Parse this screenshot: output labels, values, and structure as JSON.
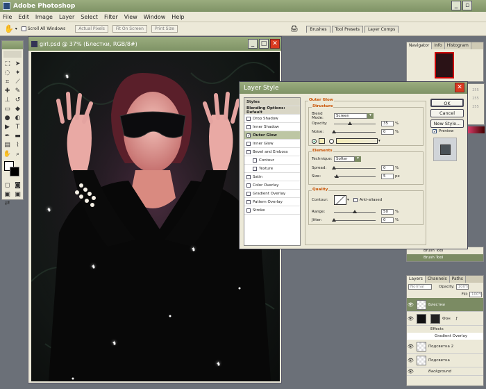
{
  "app": {
    "title": "Adobe Photoshop"
  },
  "menu": [
    "File",
    "Edit",
    "Image",
    "Layer",
    "Select",
    "Filter",
    "View",
    "Window",
    "Help"
  ],
  "options": {
    "scroll_all": "Scroll All Windows",
    "actual": "Actual Pixels",
    "fit": "Fit On Screen",
    "print": "Print Size"
  },
  "palette_well": [
    "Brushes",
    "Tool Presets",
    "Layer Comps"
  ],
  "document": {
    "title": "girl.psd @ 37% (Блестки, RGB/8#)"
  },
  "navigator": {
    "tabs": [
      "Navigator",
      "Info",
      "Histogram"
    ]
  },
  "dialog": {
    "title": "Layer Style",
    "list": [
      "Styles",
      "Blending Options: Default",
      "Drop Shadow",
      "Inner Shadow",
      "Outer Glow",
      "Inner Glow",
      "Bevel and Emboss",
      "Contour",
      "Texture",
      "Satin",
      "Color Overlay",
      "Gradient Overlay",
      "Pattern Overlay",
      "Stroke"
    ],
    "section": "Outer Glow",
    "structure": "Structure",
    "blend_label": "Blend Mode:",
    "blend_value": "Screen",
    "opacity_label": "Opacity:",
    "opacity_value": "35",
    "pct": "%",
    "noise_label": "Noise:",
    "noise_value": "0",
    "elements": "Elements",
    "technique_label": "Technique:",
    "technique_value": "Softer",
    "spread_label": "Spread:",
    "spread_value": "0",
    "size_label": "Size:",
    "size_value": "5",
    "px": "px",
    "quality": "Quality",
    "contour_label": "Contour:",
    "antialiased": "Anti-aliased",
    "range_label": "Range:",
    "range_value": "50",
    "jitter_label": "Jitter:",
    "jitter_value": "0",
    "ok": "OK",
    "cancel": "Cancel",
    "new_style": "New Style...",
    "preview": "Preview"
  },
  "history": {
    "items": [
      "Brush Tool",
      "Brush Tool"
    ]
  },
  "side_values": [
    "255",
    "255",
    "255"
  ],
  "layers": {
    "tabs": [
      "Layers",
      "Channels",
      "Paths"
    ],
    "mode": "Normal",
    "opacity_label": "Opacity:",
    "opacity_value": "100%",
    "fill_label": "Fill:",
    "fill_value": "100%",
    "rows": [
      "Блестки",
      "Фон",
      "Effects",
      "Gradient Overlay",
      "Подсветка 2",
      "Подсветка",
      "Background"
    ]
  },
  "colors": {
    "glow": "#f3ebb7",
    "accent": "#c85000"
  }
}
